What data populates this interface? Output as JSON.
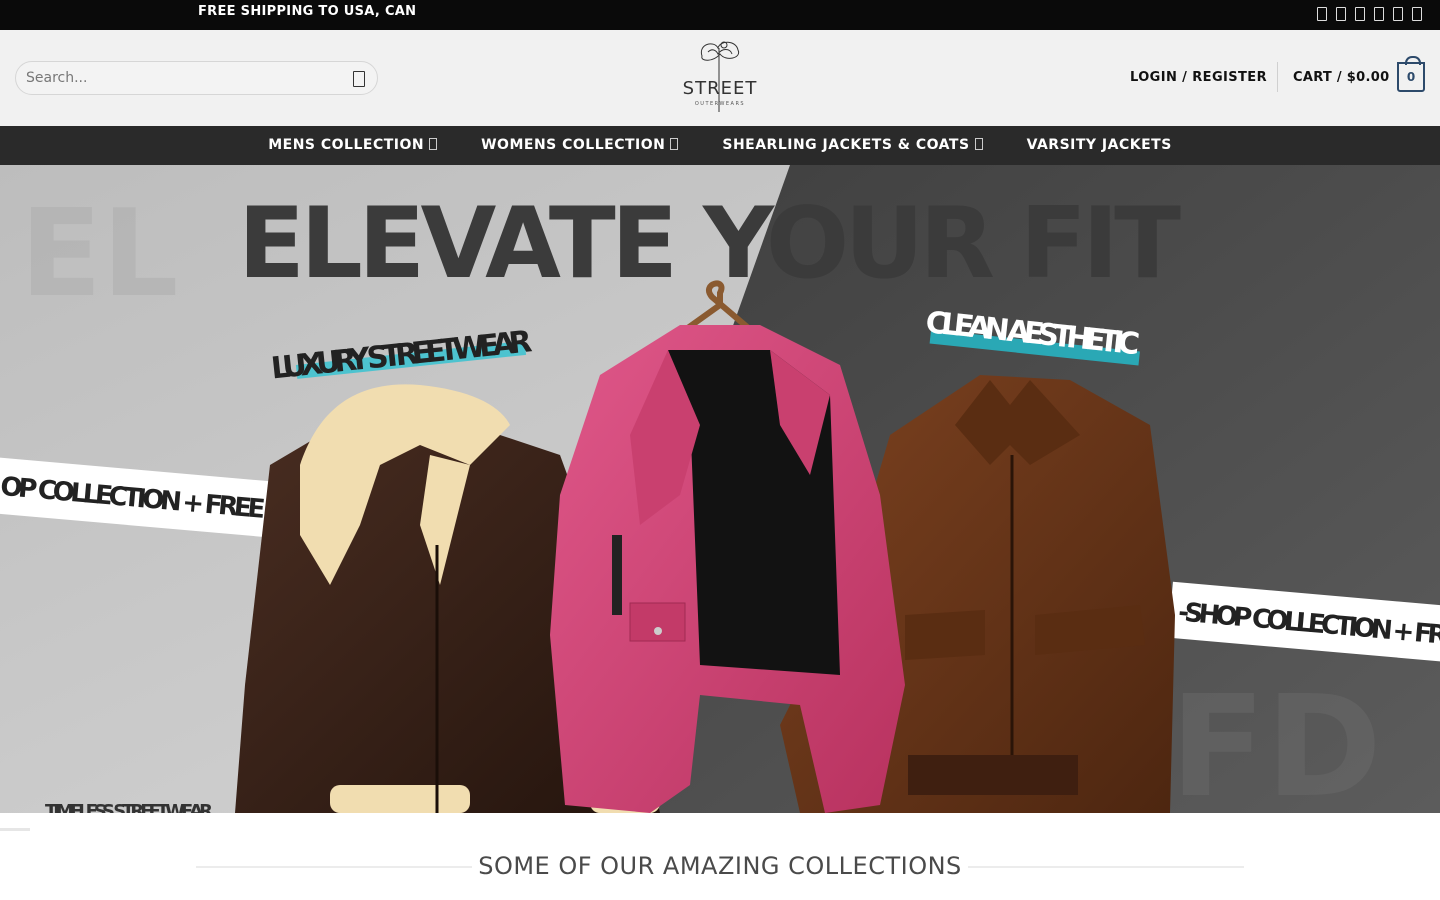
{
  "topbar": {
    "shipping": "FREE SHIPPING TO USA, CAN",
    "social_icons": [
      "facebook-icon",
      "instagram-icon",
      "twitter-icon",
      "pinterest-icon",
      "youtube-icon",
      "tiktok-icon"
    ]
  },
  "header": {
    "search_placeholder": "Search...",
    "logo": {
      "line1": "STREET",
      "line2": "OUTERWEARS"
    },
    "login": "LOGIN / REGISTER",
    "cart_label": "CART / $0.00",
    "cart_count": "0"
  },
  "nav": [
    {
      "label": "MENS COLLECTION",
      "has_dropdown": true
    },
    {
      "label": "WOMENS COLLECTION",
      "has_dropdown": true
    },
    {
      "label": "SHEARLING JACKETS & COATS",
      "has_dropdown": true
    },
    {
      "label": "VARSITY JACKETS",
      "has_dropdown": false
    }
  ],
  "hero": {
    "headline": "ELEVATE YOUR FIT",
    "tag_left": "LUXURY STREETWEAR",
    "tag_right": "CLEAN AESTHETIC",
    "ribbon_left": "OP COLLECTION + FREE S",
    "ribbon_right": "-SHOP COLLECTION + FR",
    "bottom_caption": "TIMELESS STREETWEAR",
    "colors": {
      "bg_light": "#c9c9c9",
      "bg_dark": "#4b4b4b",
      "accent": "#4dc3cf",
      "pink": "#d6467a",
      "brown": "#6b3518",
      "darkbrown": "#3a2218"
    }
  },
  "section": {
    "title": "SOME OF OUR AMAZING COLLECTIONS"
  }
}
